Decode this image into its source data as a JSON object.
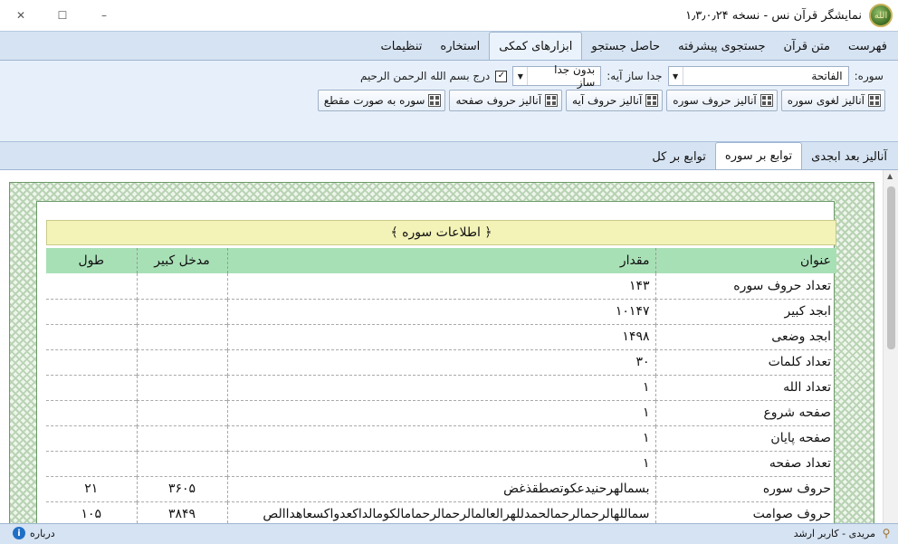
{
  "window": {
    "title": "نمایشگر قرآن نس - نسخه ۱٫۳٫۰٫۲۴",
    "logo_text": "الله",
    "minimize_glyph": "–",
    "maximize_glyph": "☐",
    "close_glyph": "✕"
  },
  "menu": {
    "tabs": [
      "فهرست",
      "متن قرآن",
      "جستجوی پیشرفته",
      "حاصل جستجو",
      "ابزارهای کمکی",
      "استخاره",
      "تنظیمات"
    ],
    "active_index": 4
  },
  "toolbar": {
    "surah_label": "سوره:",
    "surah_value": "الفاتحة",
    "separator_label": "جدا ساز آیه:",
    "separator_value": "بدون جدا ساز",
    "bismillah_checked": true,
    "bismillah_label": "درج بسم الله الرحمن الرحیم",
    "buttons": [
      "آنالیز لغوی سوره",
      "آنالیز حروف سوره",
      "آنالیز حروف آیه",
      "آنالیز حروف صفحه",
      "سوره به صورت مقطع"
    ]
  },
  "subtabs": {
    "tabs": [
      "آنالیز بعد ابجدی",
      "توابع بر سوره",
      "توابع بر کل"
    ],
    "active_index": 1
  },
  "info_table": {
    "title": "﴿ اطلاعات سوره ﴾",
    "headers": [
      "عنوان",
      "مقدار",
      "مدخل کبیر",
      "طول"
    ],
    "rows": [
      [
        "تعداد حروف سوره",
        "۱۴۳",
        "",
        ""
      ],
      [
        "ابجد کبیر",
        "۱۰۱۴۷",
        "",
        ""
      ],
      [
        "ابجد وضعی",
        "۱۴۹۸",
        "",
        ""
      ],
      [
        "تعداد کلمات",
        "۳۰",
        "",
        ""
      ],
      [
        "تعداد الله",
        "۱",
        "",
        ""
      ],
      [
        "صفحه شروع",
        "۱",
        "",
        ""
      ],
      [
        "صفحه پایان",
        "۱",
        "",
        ""
      ],
      [
        "تعداد صفحه",
        "۱",
        "",
        ""
      ],
      [
        "حروف سوره",
        "بسمالهرحنیدعکوتصطقذغض",
        "۳۶۰۵",
        "۲۱"
      ],
      [
        "حروف صوامت",
        "سماللهالرحمالرحمالحمدللهرالعالمالرحمالرحمامالکومالداکعدواکسعاهداالص",
        "۳۸۴۹",
        "۱۰۵"
      ]
    ]
  },
  "status": {
    "about": "درباره",
    "user": "مریدی - کاربر ارشد"
  }
}
